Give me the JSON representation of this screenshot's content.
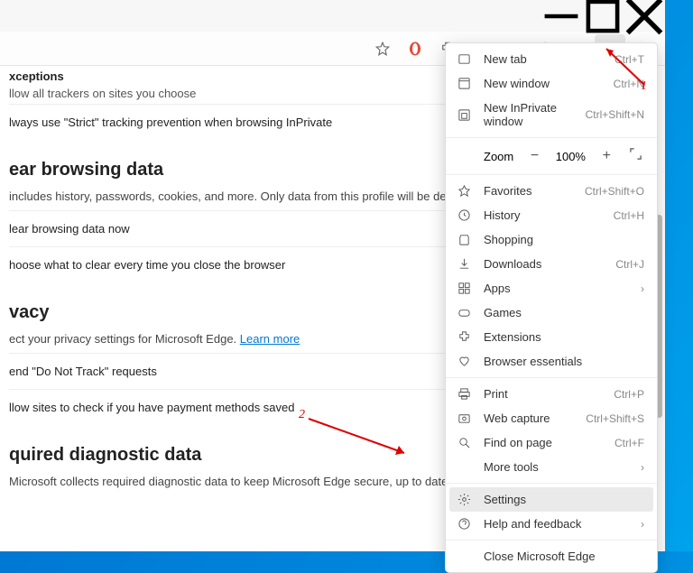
{
  "toolbar": {
    "star": "☆",
    "ext": "✦",
    "read": "▭",
    "coll": "⎘",
    "perf": "❀",
    "user": "◒",
    "dots": "⋯"
  },
  "menu": {
    "newtab": {
      "label": "New tab",
      "sc": "Ctrl+T"
    },
    "newwin": {
      "label": "New window",
      "sc": "Ctrl+N"
    },
    "newpriv": {
      "label": "New InPrivate window",
      "sc": "Ctrl+Shift+N"
    },
    "zoom": {
      "label": "Zoom",
      "pct": "100%"
    },
    "fav": {
      "label": "Favorites",
      "sc": "Ctrl+Shift+O"
    },
    "hist": {
      "label": "History",
      "sc": "Ctrl+H"
    },
    "shop": {
      "label": "Shopping"
    },
    "down": {
      "label": "Downloads",
      "sc": "Ctrl+J"
    },
    "apps": {
      "label": "Apps"
    },
    "games": {
      "label": "Games"
    },
    "ext": {
      "label": "Extensions"
    },
    "ess": {
      "label": "Browser essentials"
    },
    "print": {
      "label": "Print",
      "sc": "Ctrl+P"
    },
    "cap": {
      "label": "Web capture",
      "sc": "Ctrl+Shift+S"
    },
    "find": {
      "label": "Find on page",
      "sc": "Ctrl+F"
    },
    "more": {
      "label": "More tools"
    },
    "settings": {
      "label": "Settings"
    },
    "help": {
      "label": "Help and feedback"
    },
    "close": {
      "label": "Close Microsoft Edge"
    }
  },
  "page": {
    "exceptions": {
      "title": "xceptions",
      "sub": "llow all trackers on sites you choose"
    },
    "strict": "lways use \"Strict\" tracking prevention when browsing InPrivate",
    "clear": {
      "title": "ear browsing data",
      "desc": "includes history, passwords, cookies, and more. Only data from this profile will be delete",
      "now": "lear browsing data now",
      "choose": "hoose what to clear every time you close the browser"
    },
    "privacy": {
      "title": "vacy",
      "desc": "ect your privacy settings for Microsoft Edge. ",
      "learn": "Learn more",
      "dnt": "end \"Do Not Track\" requests",
      "pay": "llow sites to check if you have payment methods saved"
    },
    "diag": {
      "title": "quired diagnostic data",
      "desc": "Microsoft collects required diagnostic data to keep Microsoft Edge secure, up to date, and performing as expected"
    }
  },
  "annot": {
    "a1": "1",
    "a2": "2"
  }
}
